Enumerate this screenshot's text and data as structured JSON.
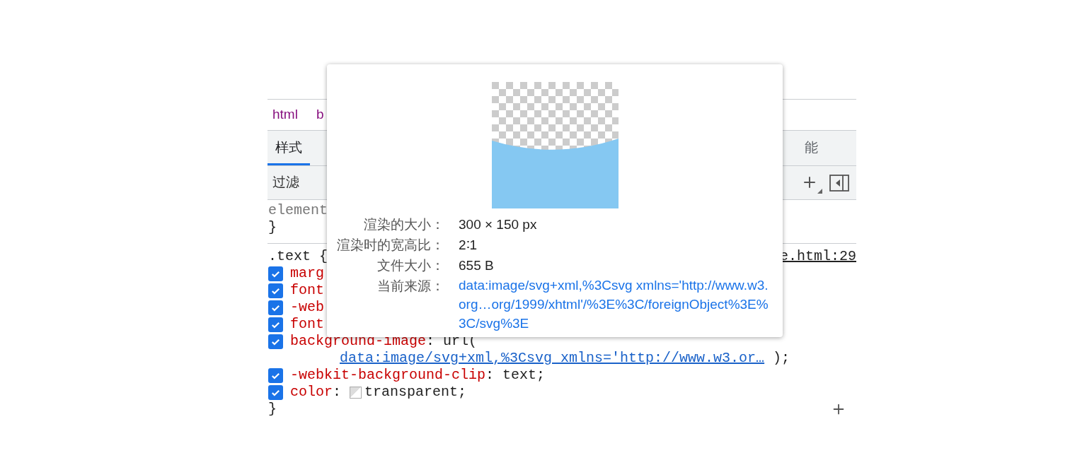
{
  "breadcrumbs": [
    {
      "label": "html"
    },
    {
      "label": "b"
    }
  ],
  "tabs": [
    {
      "label": "样式",
      "selected": true
    },
    {
      "label": "能",
      "selected": false
    }
  ],
  "filter": {
    "placeholder": "过滤"
  },
  "element_rule": {
    "selector": "element",
    "close": "}"
  },
  "text_rule": {
    "selector": ".text {",
    "source": "e.html:29",
    "close": "}",
    "declarations": [
      {
        "kind": "plain",
        "property": "marg",
        "checked": true
      },
      {
        "kind": "plain",
        "property": "font",
        "checked": true
      },
      {
        "kind": "plain",
        "property": "-web",
        "checked": true
      },
      {
        "kind": "plain",
        "property": "font",
        "checked": true
      },
      {
        "kind": "url",
        "property": "background-image",
        "separator": ":",
        "value": "url(",
        "link": "data:image/svg+xml,%3Csvg xmlns='http://www.w3.or…",
        "tail": " );",
        "checked": true
      },
      {
        "kind": "plain",
        "property": "-webkit-background-clip",
        "separator": ":",
        "value": "text;",
        "checked": true
      },
      {
        "kind": "swatch",
        "property": "color",
        "separator": ":",
        "value": "transparent;",
        "checked": true
      }
    ]
  },
  "image_popup": {
    "rows": [
      {
        "kind": "text",
        "label": "渲染的大小：",
        "value": "300 × 150 px"
      },
      {
        "kind": "text",
        "label": "渲染时的宽高比：",
        "value": "2∶1"
      },
      {
        "kind": "text",
        "label": "文件大小：",
        "value": "655 B"
      },
      {
        "kind": "link",
        "label": "当前来源：",
        "value": "data:image/svg+xml,%3Csvg xmlns='http://www.w3.org…org/1999/xhtml'/%3E%3C/foreignObject%3E%3C/svg%3E"
      }
    ]
  }
}
